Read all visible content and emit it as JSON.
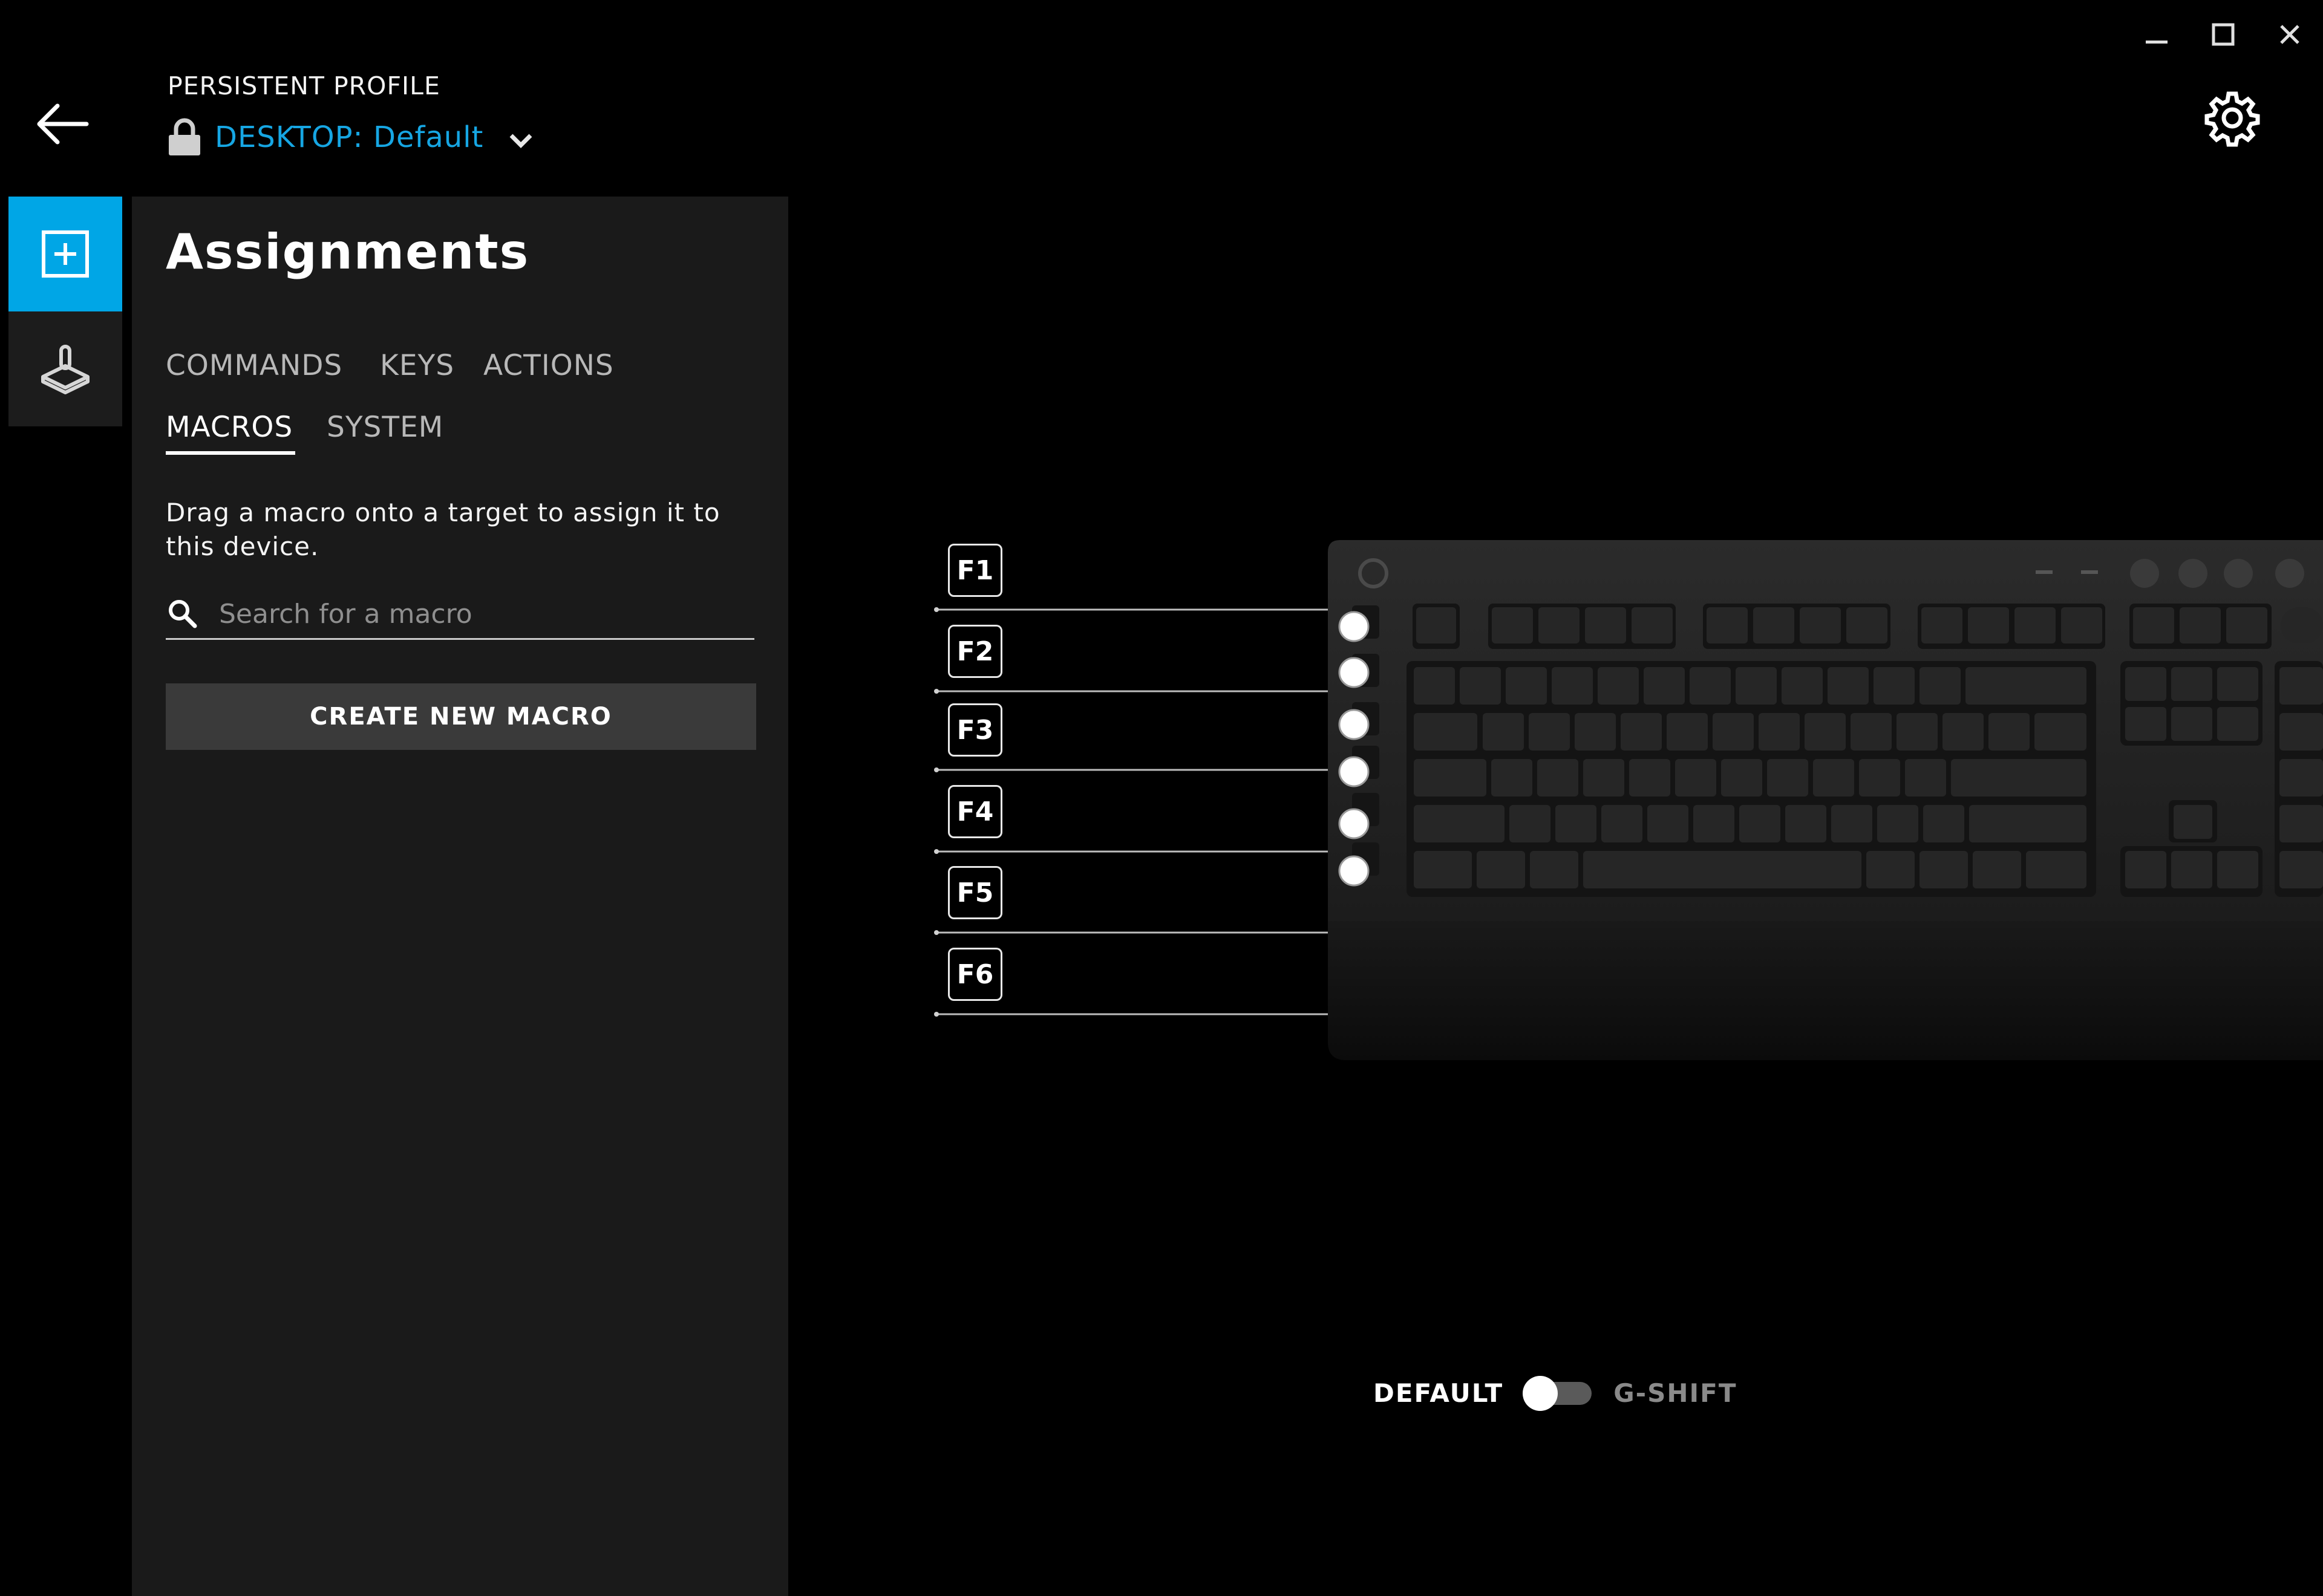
{
  "header": {
    "profile_label": "PERSISTENT PROFILE",
    "profile_name": "DESKTOP: Default"
  },
  "panel": {
    "title": "Assignments",
    "tabs": [
      {
        "label": "COMMANDS",
        "active": false
      },
      {
        "label": "KEYS",
        "active": false
      },
      {
        "label": "ACTIONS",
        "active": false
      },
      {
        "label": "MACROS",
        "active": true
      },
      {
        "label": "SYSTEM",
        "active": false
      }
    ],
    "instructions": "Drag a macro onto a target to assign it to this device.",
    "search_placeholder": "Search for a macro",
    "create_button": "CREATE NEW MACRO"
  },
  "gkeys": [
    "F1",
    "F2",
    "F3",
    "F4",
    "F5",
    "F6"
  ],
  "mode": {
    "default_label": "DEFAULT",
    "gshift_label": "G-SHIFT",
    "selected": "DEFAULT"
  },
  "colors": {
    "accent": "#16a6e3",
    "rail_active": "#00a6e6",
    "panel_bg": "#1a1a1a",
    "button_bg": "#3a3a3a"
  },
  "icons": {
    "back": "arrow-left-icon",
    "lock": "lock-icon",
    "chevron": "chevron-down-icon",
    "settings": "gear-icon",
    "assignments": "plus-square-icon",
    "heatmap": "joystick-icon",
    "search": "search-icon"
  }
}
